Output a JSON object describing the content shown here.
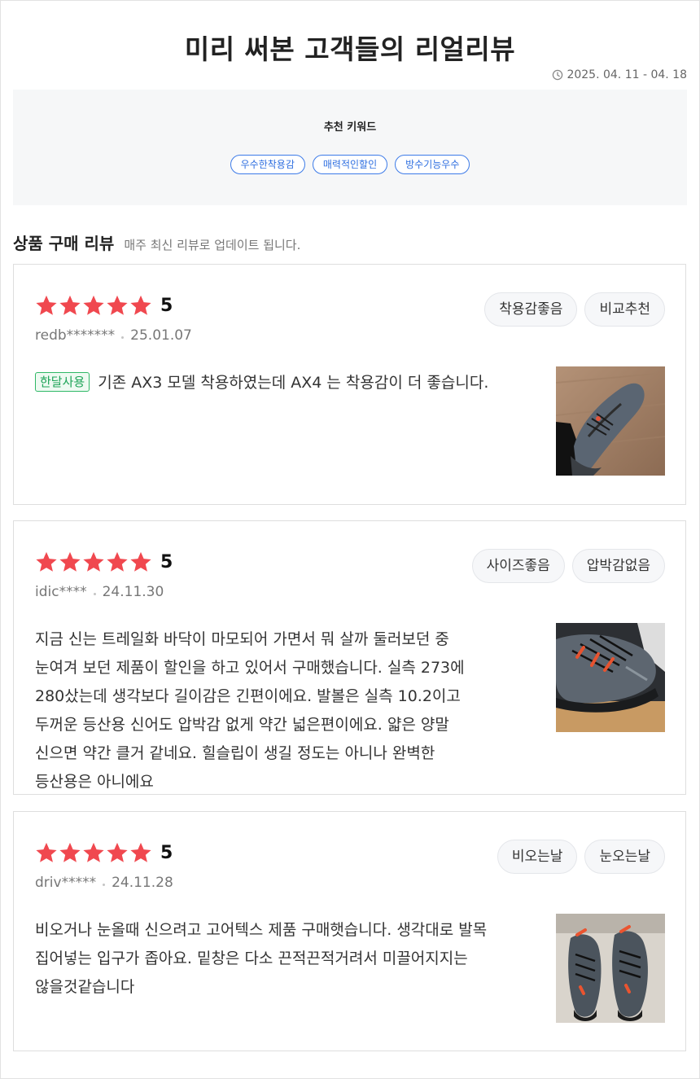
{
  "header": {
    "title": "미리 써본 고객들의 리얼리뷰",
    "period": "2025. 04. 11 - 04. 18",
    "period_icon": "clock-icon"
  },
  "keywords": {
    "title": "추천 키워드",
    "items": [
      "우수한착용감",
      "매력적인할인",
      "방수기능우수"
    ],
    "accent_color": "#3d7be8"
  },
  "section": {
    "title": "상품 구매 리뷰",
    "subtitle": "매주 최신 리뷰로 업데이트 됩니다."
  },
  "star_color": "#f0484f",
  "reviews": [
    {
      "rating": 5,
      "score": "5",
      "user": "redb*******",
      "date": "25.01.07",
      "badge": "한달사용",
      "tags": [
        "착용감좋음",
        "비교추천"
      ],
      "text": "기존 AX3 모델 착용하였는데 AX4 는 착용감이 더 좋습니다.",
      "photo": "hiking-shoe-photo"
    },
    {
      "rating": 5,
      "score": "5",
      "user": "idic****",
      "date": "24.11.30",
      "tags": [
        "사이즈좋음",
        "압박감없음"
      ],
      "text": "지금 신는 트레일화 바닥이 마모되어 가면서 뭐 살까 둘러보던 중 눈여겨 보던 제품이 할인을 하고 있어서 구매했습니다. 실측 273에 280샀는데 생각보다 길이감은 긴편이에요. 발볼은 실측 10.2이고 두꺼운 등산용 신어도 압박감 없게 약간 넓은편이에요. 얇은 양말 신으면 약간 클거 같네요. 힐슬립이 생길 정도는 아니나 완벽한 등산용은 아니에요",
      "photo": "hiking-shoe-photo"
    },
    {
      "rating": 5,
      "score": "5",
      "user": "driv*****",
      "date": "24.11.28",
      "tags": [
        "비오는날",
        "눈오는날"
      ],
      "text": "비오거나 눈올때 신으려고 고어텍스 제품 구매햇습니다. 생각대로 발목 집어넣는 입구가 좁아요. 밑창은 다소 끈적끈적거려서 미끌어지지는 않을것같습니다",
      "photo": "hiking-shoe-photo"
    }
  ]
}
